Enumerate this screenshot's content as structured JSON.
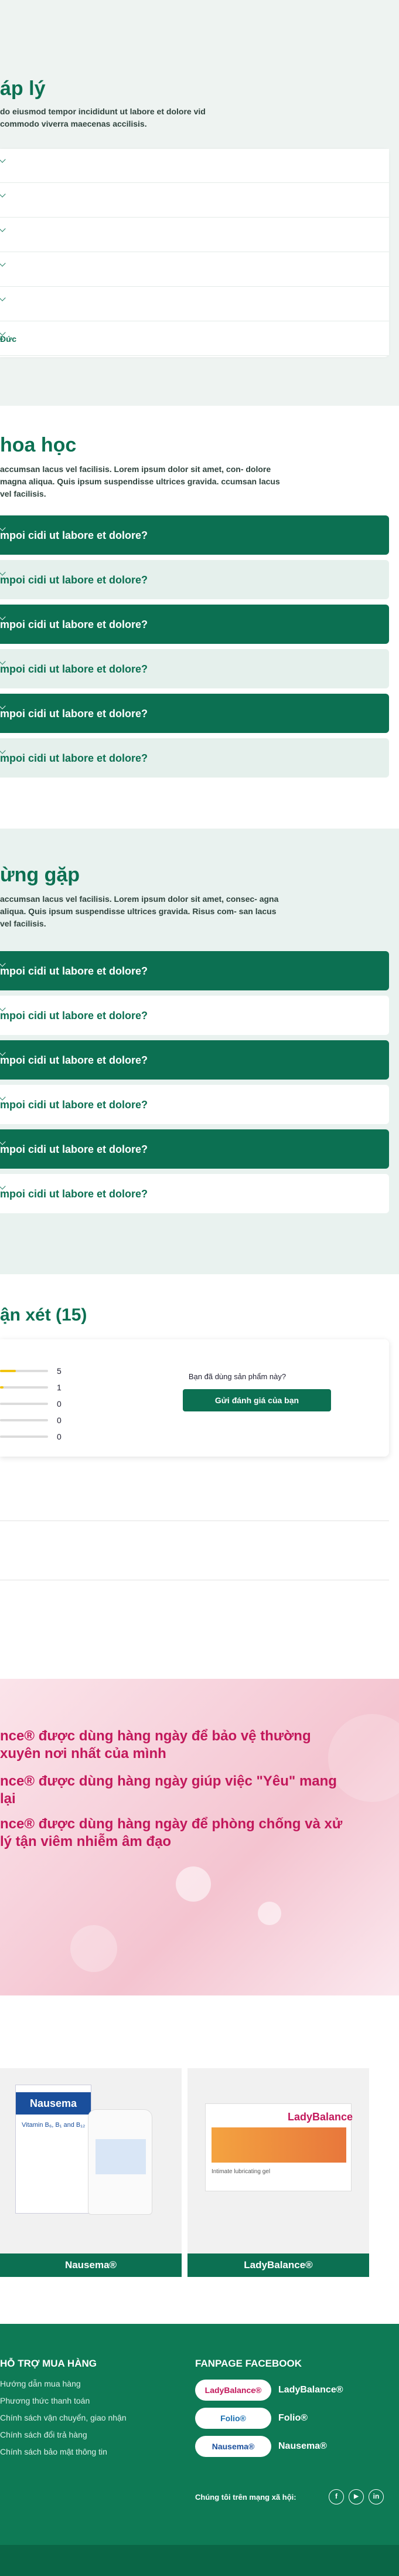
{
  "legal": {
    "title": "áp lý",
    "desc": "do eiusmod tempor incididunt ut labore et dolore vid commodo viverra maecenas accilisis.",
    "rows": [
      "",
      "",
      "",
      "",
      "",
      "Đức"
    ]
  },
  "science": {
    "title": "hoa học",
    "desc": "accumsan lacus vel facilisis. Lorem ipsum dolor sit amet, con- dolore magna aliqua. Quis ipsum suspendisse ultrices gravida. ccumsan lacus vel facilisis.",
    "items": [
      {
        "label": "mpoi cidi ut labore et dolore?",
        "style": "dk"
      },
      {
        "label": "mpoi cidi ut labore et dolore?",
        "style": "lt"
      },
      {
        "label": "mpoi cidi ut labore et dolore?",
        "style": "dk"
      },
      {
        "label": "mpoi cidi ut labore et dolore?",
        "style": "lt"
      },
      {
        "label": "mpoi cidi ut labore et dolore?",
        "style": "dk"
      },
      {
        "label": "mpoi cidi ut labore et dolore?",
        "style": "lt"
      }
    ]
  },
  "faq": {
    "title": "ừng gặp",
    "desc": "accumsan lacus vel facilisis. Lorem ipsum dolor sit amet, consec- agna aliqua. Quis ipsum suspendisse ultrices gravida. Risus com- san lacus vel facilisis.",
    "items": [
      {
        "label": "mpoi cidi ut labore et dolore?",
        "style": "dk"
      },
      {
        "label": "mpoi cidi ut labore et dolore?",
        "style": "wh"
      },
      {
        "label": "mpoi cidi ut labore et dolore?",
        "style": "dk"
      },
      {
        "label": "mpoi cidi ut labore et dolore?",
        "style": "wh"
      },
      {
        "label": "mpoi cidi ut labore et dolore?",
        "style": "dk"
      },
      {
        "label": "mpoi cidi ut labore et dolore?",
        "style": "wh"
      }
    ]
  },
  "reviews": {
    "title": "ận xét (15)",
    "counts": [
      {
        "label": "5",
        "fill": 0.33
      },
      {
        "label": "1",
        "fill": 0.07
      },
      {
        "label": "0",
        "fill": 0
      },
      {
        "label": "0",
        "fill": 0
      },
      {
        "label": "0",
        "fill": 0
      }
    ],
    "question": "Bạn đã dùng sản phẩm này?",
    "button": "Gửi đánh giá của bạn"
  },
  "banner": {
    "lines": [
      "nce® được dùng hàng ngày để bảo vệ thường xuyên nơi nhất của mình",
      "nce® được dùng hàng ngày giúp việc \"Yêu\" mang lại",
      "nce® được dùng hàng ngày để phòng chống và xử lý tận viêm nhiễm âm đạo"
    ]
  },
  "products": [
    {
      "name": "Nausema®",
      "brand": "Nausema",
      "sub": "Vitamin B₆, B₁ and B₁₂"
    },
    {
      "name": "LadyBalance®",
      "brand": "LadyBalance",
      "sub": "Intimate lubricating gel"
    }
  ],
  "footer": {
    "support_title": "HỖ TRỢ MUA HÀNG",
    "links": [
      "Hướng dẫn mua hàng",
      "Phương thức thanh toán",
      "Chính sách vận chuyển, giao nhận",
      "Chính sách đổi trả hàng",
      "Chính sách bảo mật thông tin"
    ],
    "fanpage_title": "FANPAGE FACEBOOK",
    "pages": [
      {
        "logo": "LadyBalance®",
        "name": "LadyBalance®",
        "color": "#c2185b"
      },
      {
        "logo": "Folio®",
        "name": "Folio®",
        "color": "#1a6fb0"
      },
      {
        "logo": "Nausema®",
        "name": "Nausema®",
        "color": "#1a4f9c"
      }
    ],
    "social_label": "Chúng tôi trên mạng xã hội:",
    "social": [
      "f",
      "▶",
      "in"
    ]
  }
}
